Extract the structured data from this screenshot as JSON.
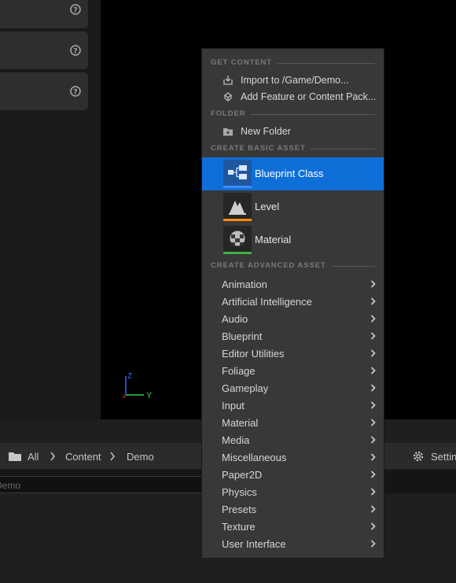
{
  "details_panel": {
    "rows": [
      {
        "help_icon": "question-circle-icon"
      },
      {
        "help_icon": "question-circle-icon"
      },
      {
        "help_icon": "question-circle-icon"
      }
    ]
  },
  "viewport": {
    "axis_labels": {
      "z": "Z",
      "y": "Y"
    },
    "colors": {
      "z_axis": "#3a64ff",
      "y_axis": "#2ecc40",
      "x_axis": "#ff3030"
    }
  },
  "content_browser": {
    "breadcrumb": [
      "All",
      "Content",
      "Demo"
    ],
    "settings_label": "Settings",
    "search_text": "Demo"
  },
  "context_menu": {
    "sections": {
      "get_content": "GET CONTENT",
      "folder": "FOLDER",
      "create_basic_asset": "CREATE BASIC ASSET",
      "create_advanced_asset": "CREATE ADVANCED ASSET"
    },
    "get_content_items": [
      {
        "label": "Import to /Game/Demo...",
        "icon": "import-icon"
      },
      {
        "label": "Add Feature or Content Pack...",
        "icon": "content-pack-icon"
      }
    ],
    "folder_items": [
      {
        "label": "New Folder",
        "icon": "new-folder-icon"
      }
    ],
    "basic_assets": [
      {
        "label": "Blueprint Class",
        "icon": "blueprint-class-icon",
        "bar_color": "#3b8cff",
        "selected": true
      },
      {
        "label": "Level",
        "icon": "level-icon",
        "bar_color": "#ff8c00",
        "selected": false
      },
      {
        "label": "Material",
        "icon": "material-icon",
        "bar_color": "#3cb043",
        "selected": false
      }
    ],
    "advanced_assets": [
      "Animation",
      "Artificial Intelligence",
      "Audio",
      "Blueprint",
      "Editor Utilities",
      "Foliage",
      "Gameplay",
      "Input",
      "Material",
      "Media",
      "Miscellaneous",
      "Paper2D",
      "Physics",
      "Presets",
      "Texture",
      "User Interface"
    ],
    "selection_color": "#0f6fd8"
  }
}
